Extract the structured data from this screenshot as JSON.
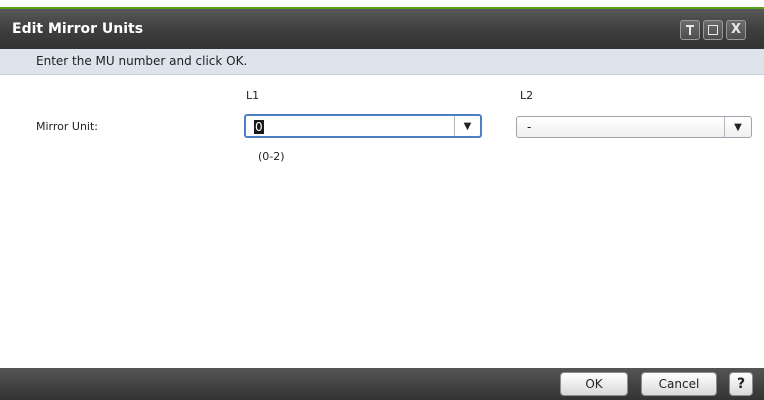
{
  "dialog": {
    "title": "Edit Mirror Units",
    "window_icons": [
      "pin-icon",
      "maximize-icon",
      "close-icon"
    ],
    "close_glyph": "X",
    "accent_color": "#58a21e"
  },
  "banner": {
    "instruction": "Enter the MU number and click OK."
  },
  "form": {
    "columns": {
      "l1": "L1",
      "l2": "L2"
    },
    "mirror_unit_label": "Mirror Unit:",
    "l1_value": "0",
    "l2_value": "-",
    "range_hint": "(0-2)",
    "dropdown_glyph": "▼"
  },
  "footer": {
    "ok_label": "OK",
    "cancel_label": "Cancel",
    "help_label": "?"
  }
}
